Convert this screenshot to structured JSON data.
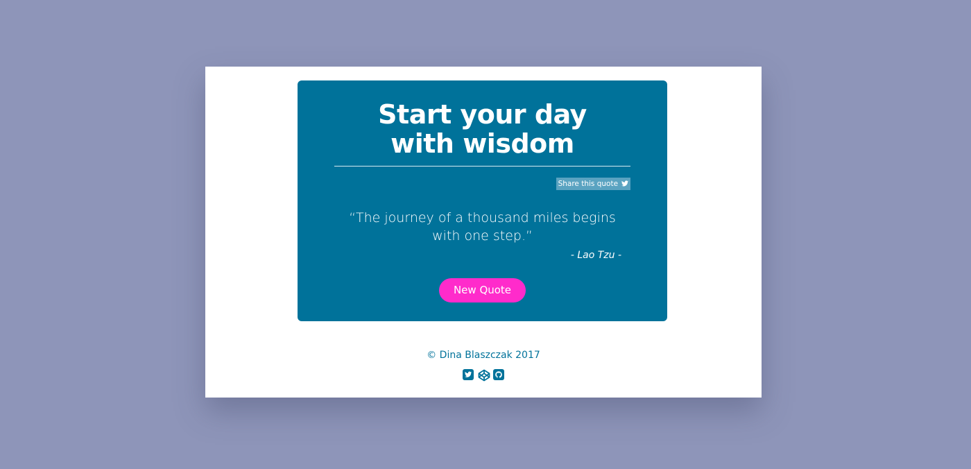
{
  "colors": {
    "background": "#8e95b9",
    "card": "#ffffff",
    "quote_box": "#00729a",
    "share_button": "#5aa3c1",
    "accent_button": "#ff2bcb",
    "footer_text": "#00729a"
  },
  "header": {
    "title_line1": "Start your day",
    "title_line2": "with wisdom"
  },
  "share": {
    "label": "Share this quote",
    "icon": "twitter-icon"
  },
  "quote": {
    "text": "“The journey of a thousand miles begins with one step.”",
    "author": "- Lao Tzu -"
  },
  "actions": {
    "new_quote_label": "New Quote"
  },
  "footer": {
    "copyright": "© Dina Blaszczak 2017",
    "social_icons": [
      "twitter-icon",
      "codepen-icon",
      "github-icon"
    ]
  }
}
